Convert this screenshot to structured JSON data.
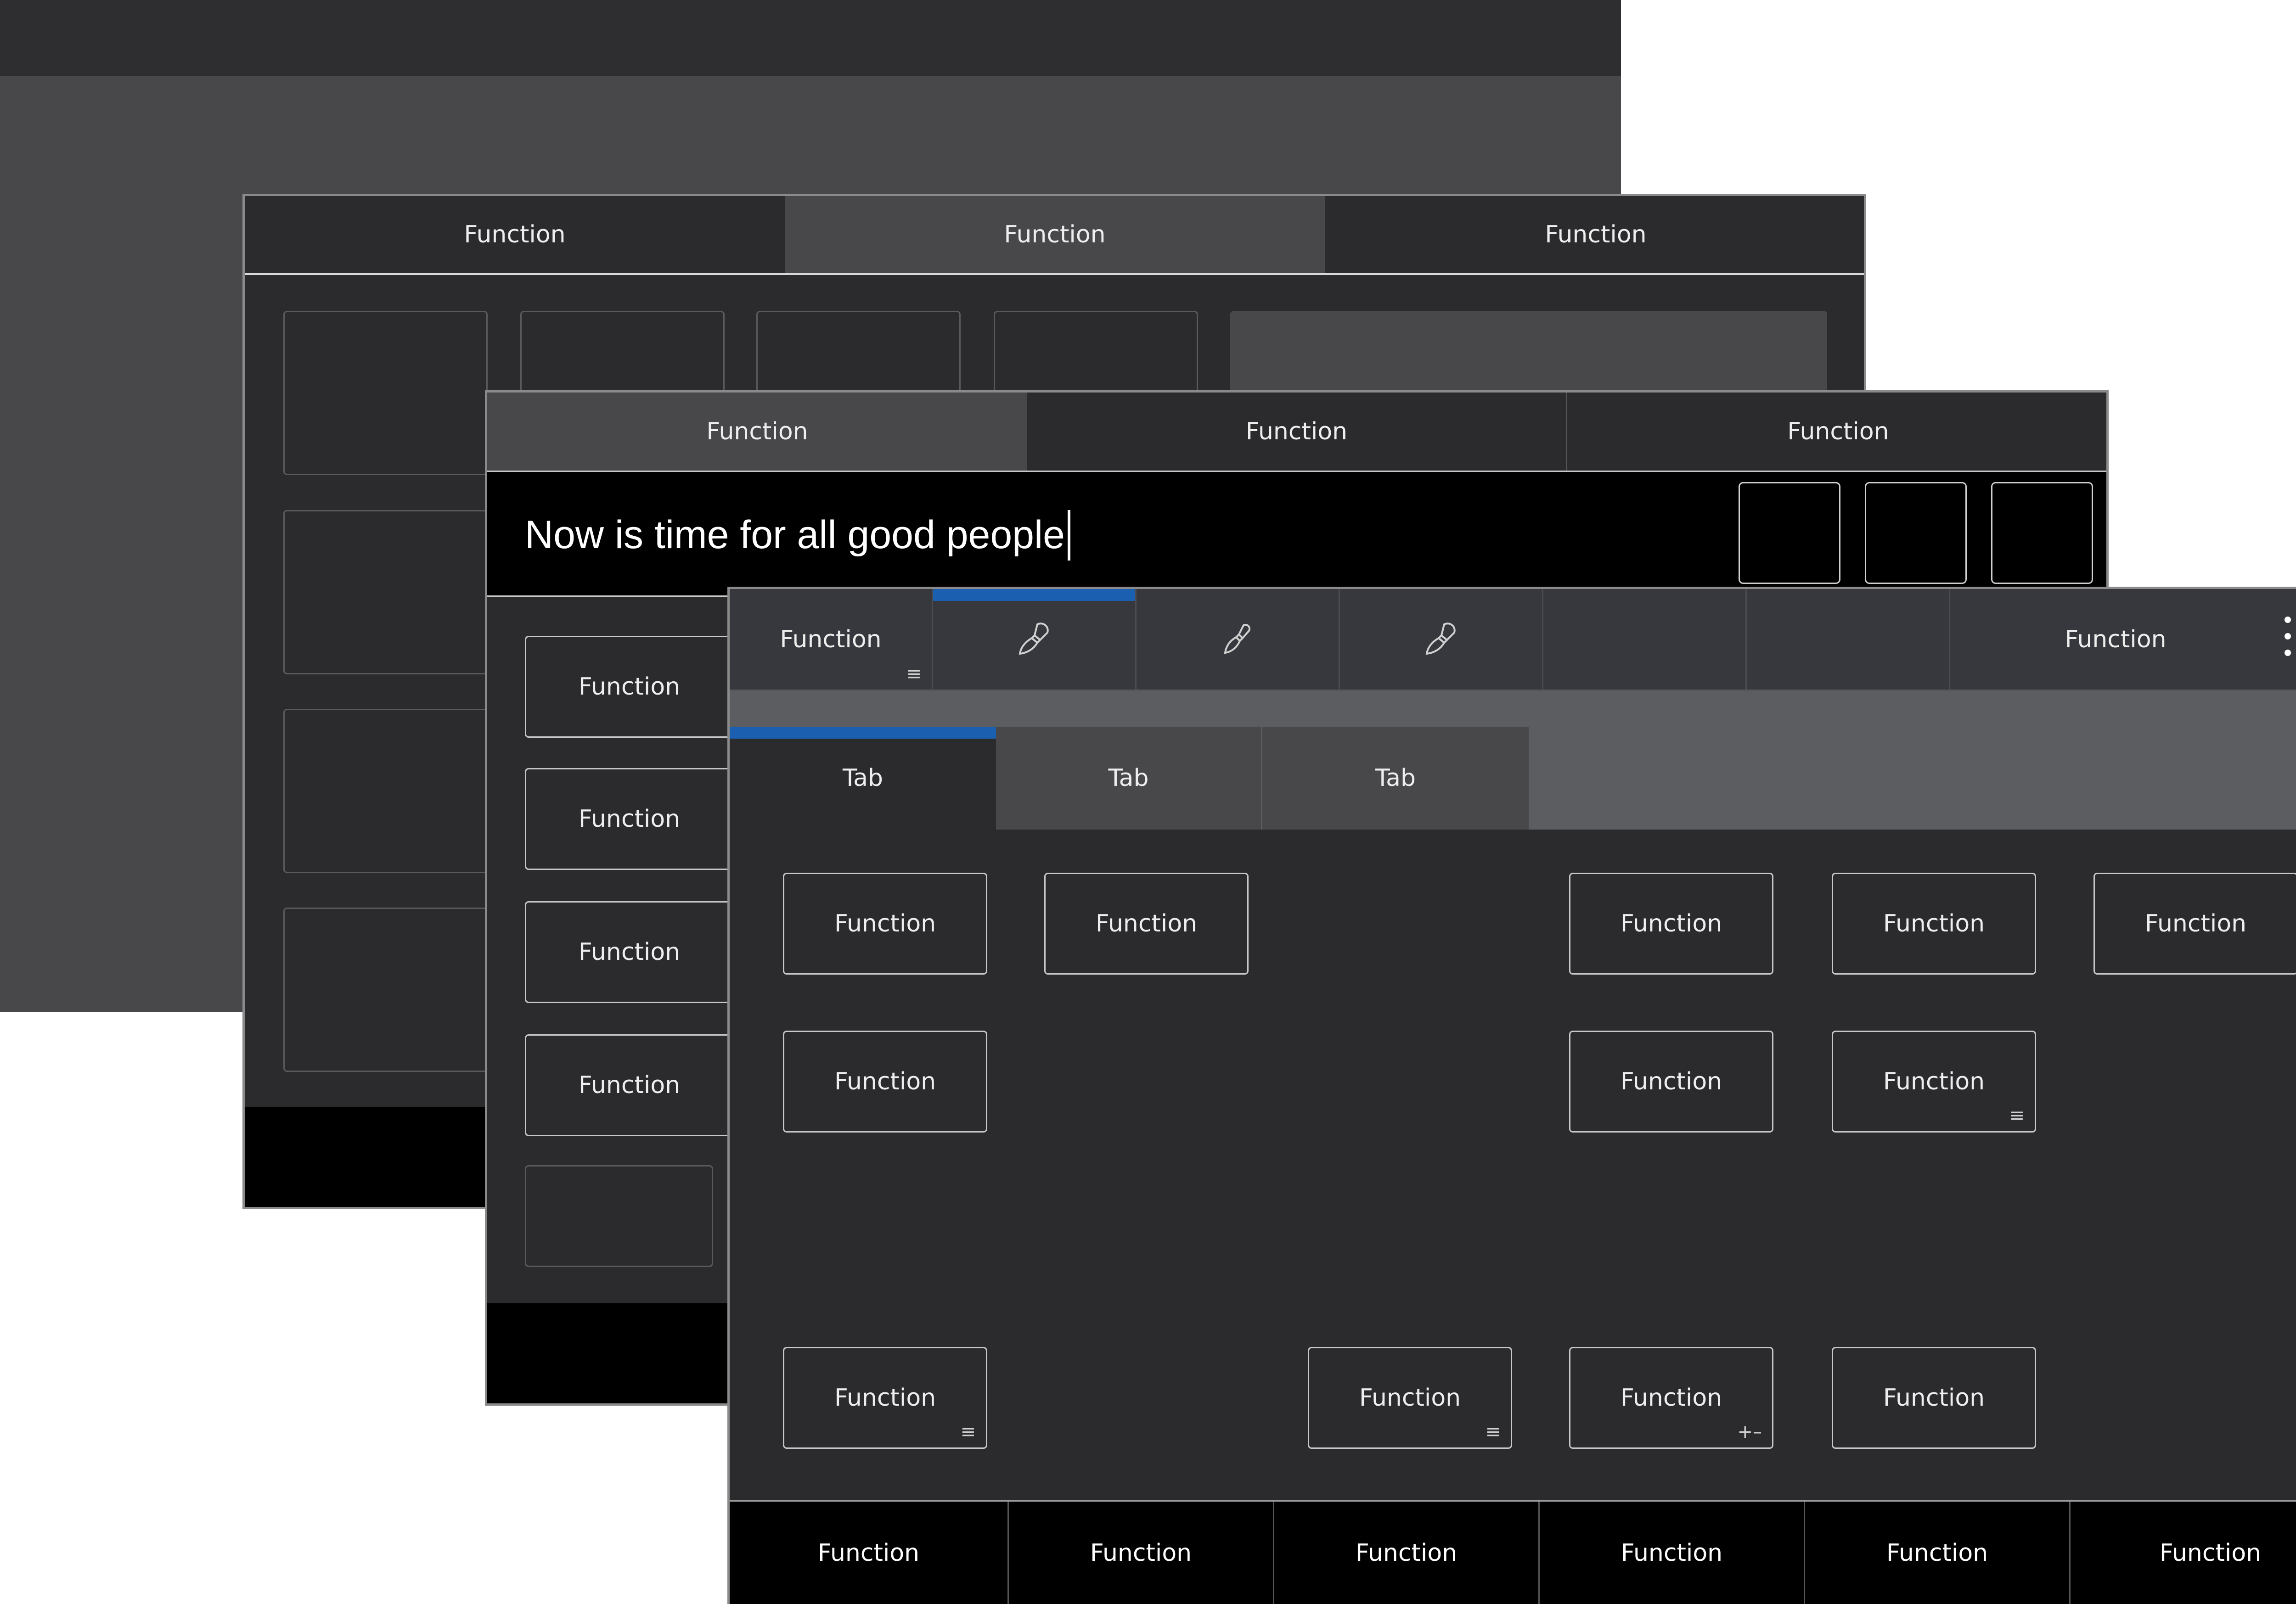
{
  "layer2": {
    "tabs": [
      "Function",
      "Function",
      "Function"
    ]
  },
  "layer3": {
    "tabs": [
      "Function",
      "Function",
      "Function"
    ],
    "text_input": "Now is time for all good people",
    "side_buttons": [
      "Function",
      "Function",
      "Function",
      "Function"
    ]
  },
  "layer4": {
    "toolbar": {
      "first_label": "Function",
      "last_label": "Function",
      "tool_icons": [
        "paintbrush-icon",
        "paintbrush-icon",
        "paintbrush-icon"
      ]
    },
    "tabs": [
      "Tab",
      "Tab",
      "Tab"
    ],
    "grid_buttons": {
      "r1c1": "Function",
      "r1c2": "Function",
      "r1c4": "Function",
      "r1c5": "Function",
      "r1c6": "Function",
      "r2c1": "Function",
      "r2c4": "Function",
      "r2c5": "Function",
      "r3c1": "Function",
      "r3c3": "Function",
      "r3c4": "Function",
      "r3c5": "Function"
    },
    "plus_minus": "+–",
    "bottom_bar": [
      "Function",
      "Function",
      "Function",
      "Function",
      "Function",
      "Function"
    ]
  },
  "colors": {
    "accent_blue": "#1a5fb0",
    "panel_dark": "#2b2b2e",
    "panel_mid": "#48484b",
    "black": "#000000"
  }
}
